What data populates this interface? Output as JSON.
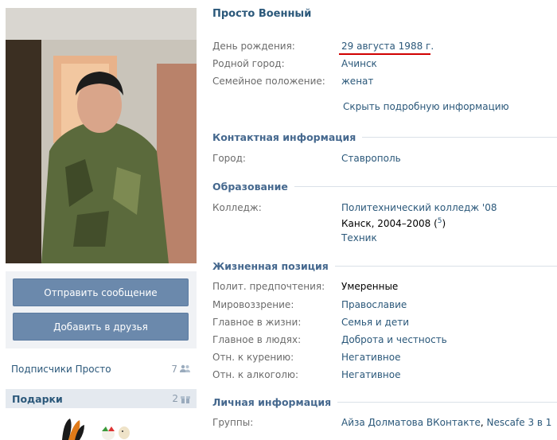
{
  "profile": {
    "name": "Просто Военный",
    "hide_link": "Скрыть подробную информацию"
  },
  "basic": [
    {
      "label": "День рождения:",
      "value": "29 августа 1988 г."
    },
    {
      "label": "Родной город:",
      "value": "Ачинск"
    },
    {
      "label": "Семейное положение:",
      "value": "женат"
    }
  ],
  "contacts": {
    "title": "Контактная информация",
    "city_label": "Город:",
    "city_value": "Ставрополь"
  },
  "education": {
    "title": "Образование",
    "label": "Колледж:",
    "college": "Политехнический колледж '08",
    "place_years": "Канск, 2004–2008 (",
    "sup": "5",
    "sup_close": ")",
    "speciality": "Техник"
  },
  "life": {
    "title": "Жизненная позиция",
    "rows": [
      {
        "label": "Полит. предпочтения:",
        "value": "Умеренные"
      },
      {
        "label": "Мировоззрение:",
        "value": "Православие"
      },
      {
        "label": "Главное в жизни:",
        "value": "Семья и дети"
      },
      {
        "label": "Главное в людях:",
        "value": "Доброта и честность"
      },
      {
        "label": "Отн. к курению:",
        "value": "Негативное"
      },
      {
        "label": "Отн. к алкоголю:",
        "value": "Негативное"
      }
    ]
  },
  "personal": {
    "title": "Личная информация",
    "groups_label": "Группы:",
    "groups_a": "Айза Долматова ВКонтакте",
    "groups_sep": ", ",
    "groups_b": "Nescafe 3 в 1"
  },
  "sidebar": {
    "send_message": "Отправить сообщение",
    "add_friend": "Добавить в друзья",
    "subscribers_label": "Подписчики Просто",
    "subscribers_count": "7",
    "gifts_label": "Подарки",
    "gifts_count": "2"
  },
  "colors": {
    "link": "#2b587a",
    "section_title": "#45688e",
    "button": "#6b89ac",
    "highlight_underline": "#d00000"
  }
}
